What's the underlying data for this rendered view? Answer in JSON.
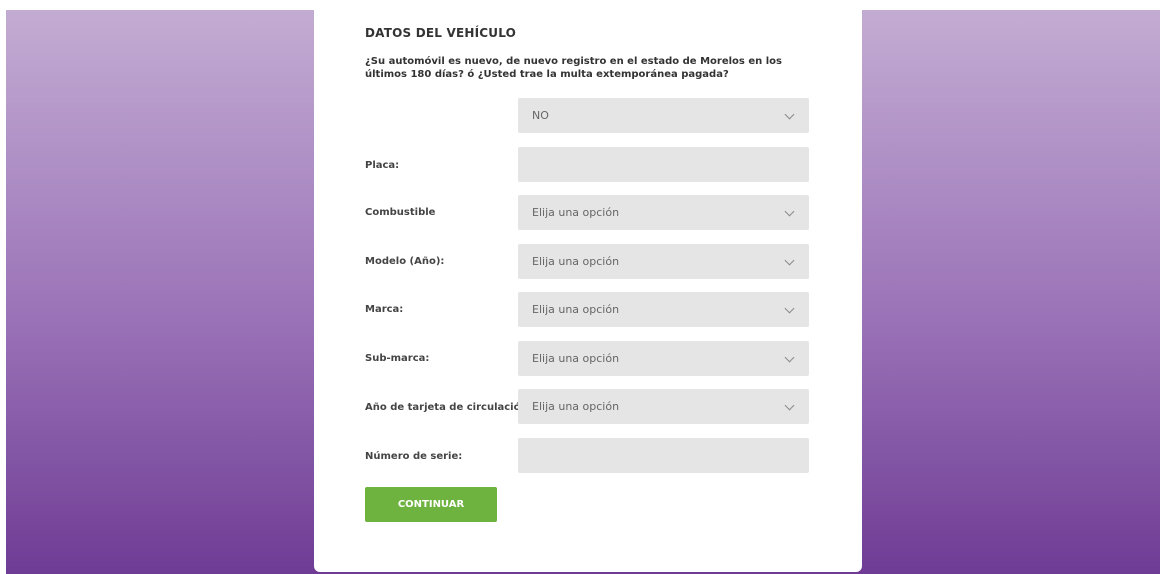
{
  "section_title": "DATOS DEL VEHÍCULO",
  "question": "¿Su automóvil es nuevo, de nuevo registro en el estado de Morelos en los últimos 180 días? ó ¿Usted trae la multa extemporánea pagada?",
  "nuevo_select": {
    "value": "NO"
  },
  "fields": {
    "placa": {
      "label": "Placa:",
      "value": ""
    },
    "combustible": {
      "label": "Combustible",
      "value": "Elija una opción"
    },
    "modelo": {
      "label": "Modelo (Año):",
      "value": "Elija una opción"
    },
    "marca": {
      "label": "Marca:",
      "value": "Elija una opción"
    },
    "submarca": {
      "label": "Sub-marca:",
      "value": "Elija una opción"
    },
    "anio_tarjeta": {
      "label": "Año de tarjeta de circulación:",
      "value": "Elija una opción"
    },
    "numero_serie": {
      "label": "Número de serie:",
      "value": ""
    }
  },
  "continue_button": "CONTINUAR",
  "colors": {
    "background_top": "#c3acd3",
    "background_bottom": "#6f3c95",
    "field_bg": "#e5e5e5",
    "button": "#6eb33f"
  },
  "icons": {
    "select_arrow": "chevron-down-icon"
  }
}
